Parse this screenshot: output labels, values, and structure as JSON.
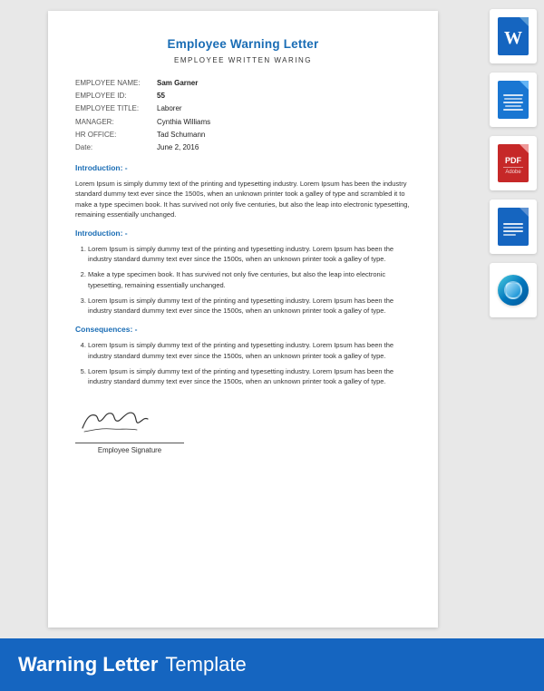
{
  "document": {
    "title": "Employee Warning Letter",
    "subtitle": "EMPLOYEE WRITTEN WARING",
    "fields": [
      {
        "label": "EMPLOYEE NAME:",
        "value": "Sam Garner",
        "bold": true
      },
      {
        "label": "EMPLOYEE ID:",
        "value": "55",
        "bold": true
      },
      {
        "label": "EMPLOYEE TITLE:",
        "value": "Laborer",
        "bold": false
      },
      {
        "label": "MANAGER:",
        "value": "Cynthia Williams",
        "bold": false
      },
      {
        "label": "HR OFFICE:",
        "value": "Tad Schumann",
        "bold": false
      },
      {
        "label": "Date:",
        "value": "June 2, 2016",
        "bold": false
      }
    ],
    "sections": [
      {
        "heading": "Introduction: -",
        "type": "paragraph",
        "text": "Lorem Ipsum is simply dummy text of the printing and typesetting industry. Lorem Ipsum has been the industry standard dummy text ever since the 1500s, when an unknown printer took a galley of type and scrambled it to make a type specimen book. It has survived not only five centuries, but also the leap into electronic typesetting, remaining essentially unchanged."
      },
      {
        "heading": "Introduction: -",
        "type": "list",
        "items": [
          "Lorem Ipsum is simply dummy text of the printing and typesetting industry. Lorem Ipsum has been the industry standard dummy text ever since the 1500s, when an unknown printer took a galley of type.",
          "Make a type specimen book. It has survived not only five centuries, but also the leap into electronic typesetting, remaining essentially unchanged.",
          "Lorem Ipsum is simply dummy text of the printing and typesetting industry. Lorem Ipsum has been the industry standard dummy text ever since the 1500s, when an unknown printer took a galley of type."
        ],
        "start": 1
      },
      {
        "heading": "Consequences: -",
        "type": "list",
        "items": [
          "Lorem Ipsum is simply dummy text of the printing and typesetting industry. Lorem Ipsum has been the industry standard dummy text ever since the 1500s, when an unknown printer took a galley of type.",
          "Lorem Ipsum is simply dummy text of the printing and typesetting industry. Lorem Ipsum has been the industry standard dummy text ever since the 1500s, when an unknown printer took a galley of type."
        ],
        "start": 4
      }
    ],
    "signature_label": "Employee Signature"
  },
  "sidebar": {
    "icons": [
      {
        "type": "word",
        "label": "Word Icon 1"
      },
      {
        "type": "word2",
        "label": "Word Icon 2"
      },
      {
        "type": "pdf",
        "label": "PDF Icon"
      },
      {
        "type": "doc",
        "label": "Doc Icon"
      },
      {
        "type": "openoffice",
        "label": "OpenOffice Icon"
      }
    ]
  },
  "bottom_bar": {
    "bold_text": "Warning Letter",
    "normal_text": "Template"
  }
}
